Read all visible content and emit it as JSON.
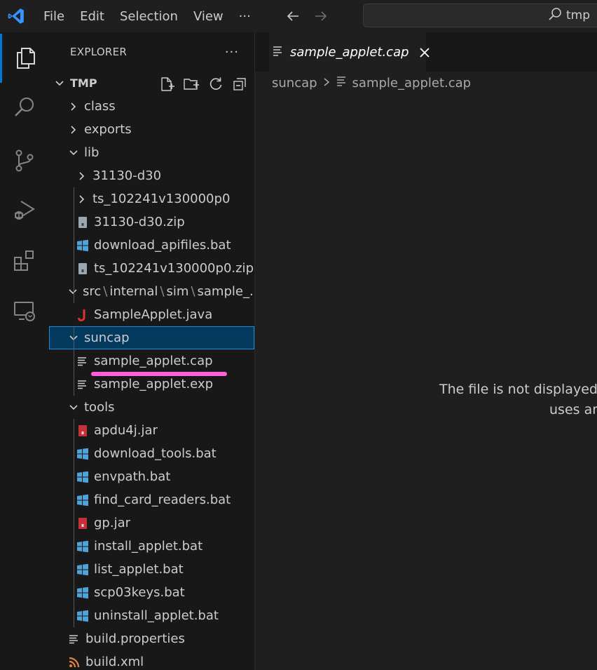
{
  "menu": [
    "File",
    "Edit",
    "Selection",
    "View",
    "···"
  ],
  "search": {
    "text": "tmp"
  },
  "explorer": {
    "title": "EXPLORER",
    "more": "···",
    "root": "TMP",
    "rows": [
      {
        "label": "class",
        "indent": 1,
        "type": "folder",
        "state": "closed"
      },
      {
        "label": "exports",
        "indent": 1,
        "type": "folder",
        "state": "closed"
      },
      {
        "label": "lib",
        "indent": 1,
        "type": "folder",
        "state": "open"
      },
      {
        "label": "31130-d30",
        "indent": 2,
        "type": "folder",
        "state": "closed"
      },
      {
        "label": "ts_102241v130000p0",
        "indent": 2,
        "type": "folder",
        "state": "closed"
      },
      {
        "label": "31130-d30.zip",
        "indent": 2,
        "type": "zip"
      },
      {
        "label": "download_apifiles.bat",
        "indent": 2,
        "type": "bat"
      },
      {
        "label": "ts_102241v130000p0.zip",
        "indent": 2,
        "type": "zip"
      },
      {
        "label": "src\\internal\\sim\\sample_...",
        "indent": 1,
        "type": "folder",
        "state": "open",
        "compact": [
          "src",
          "internal",
          "sim",
          "sample_..."
        ]
      },
      {
        "label": "SampleApplet.java",
        "indent": 2,
        "type": "java"
      },
      {
        "label": "suncap",
        "indent": 1,
        "type": "folder",
        "state": "open",
        "selected": true
      },
      {
        "label": "sample_applet.cap",
        "indent": 2,
        "type": "text"
      },
      {
        "label": "sample_applet.exp",
        "indent": 2,
        "type": "text"
      },
      {
        "label": "tools",
        "indent": 1,
        "type": "folder",
        "state": "open"
      },
      {
        "label": "apdu4j.jar",
        "indent": 2,
        "type": "jar"
      },
      {
        "label": "download_tools.bat",
        "indent": 2,
        "type": "bat"
      },
      {
        "label": "envpath.bat",
        "indent": 2,
        "type": "bat"
      },
      {
        "label": "find_card_readers.bat",
        "indent": 2,
        "type": "bat"
      },
      {
        "label": "gp.jar",
        "indent": 2,
        "type": "jar"
      },
      {
        "label": "install_applet.bat",
        "indent": 2,
        "type": "bat"
      },
      {
        "label": "list_applet.bat",
        "indent": 2,
        "type": "bat"
      },
      {
        "label": "scp03keys.bat",
        "indent": 2,
        "type": "bat"
      },
      {
        "label": "uninstall_applet.bat",
        "indent": 2,
        "type": "bat"
      },
      {
        "label": "build.properties",
        "indent": 1,
        "type": "text"
      },
      {
        "label": "build.xml",
        "indent": 1,
        "type": "rss"
      }
    ]
  },
  "editor": {
    "tab_label": "sample_applet.cap",
    "breadcrumb": [
      "suncap",
      "sample_applet.cap"
    ],
    "message_line1": "The file is not displayed",
    "message_line2": "uses an"
  },
  "colors": {
    "accent": "#0078d4",
    "vscode_blue": "#3794ff",
    "bat_icon": "#4fa3d8",
    "java_icon": "#d9342b",
    "jar_icon": "#c3323a",
    "rss_icon": "#e2803f",
    "highlight": "#ff5fd8"
  }
}
